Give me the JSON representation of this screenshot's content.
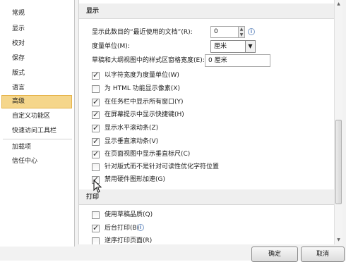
{
  "sidebar": {
    "items": [
      {
        "label": "常规"
      },
      {
        "label": "显示"
      },
      {
        "label": "校对"
      },
      {
        "label": "保存"
      },
      {
        "label": "版式"
      },
      {
        "label": "语言"
      },
      {
        "label": "高级",
        "selected": true
      },
      {
        "label": "自定义功能区"
      },
      {
        "label": "快速访问工具栏"
      },
      {
        "label": "加载项"
      },
      {
        "label": "信任中心"
      }
    ]
  },
  "display_section": {
    "title": "显示",
    "recent_docs_label": "显示此数目的“最近使用的文档”(R):",
    "recent_docs_value": "0",
    "units_label": "度量单位(M):",
    "units_value": "厘米",
    "style_width_label": "草稿和大纲视图中的样式区窗格宽度(E):",
    "style_width_value": "0 厘米",
    "options": [
      {
        "label": "以字符宽度为度量单位(W)",
        "checked": true
      },
      {
        "label": "为 HTML 功能显示像素(X)",
        "checked": false
      },
      {
        "label": "在任务栏中显示所有窗口(Y)",
        "checked": true
      },
      {
        "label": "在屏幕提示中显示快捷键(H)",
        "checked": true
      },
      {
        "label": "显示水平滚动条(Z)",
        "checked": true
      },
      {
        "label": "显示垂直滚动条(V)",
        "checked": true
      },
      {
        "label": "在页面视图中显示垂直标尺(C)",
        "checked": true
      },
      {
        "label": "针对版式而不是针对可读性优化字符位置",
        "checked": false
      },
      {
        "label": "禁用硬件图形加速(G)",
        "checked": true
      }
    ]
  },
  "print_section": {
    "title": "打印",
    "options": [
      {
        "label": "使用草稿品质(Q)",
        "checked": false
      },
      {
        "label": "后台打印(B)",
        "checked": true
      },
      {
        "label": "逆序打印页面(R)",
        "checked": false
      }
    ]
  },
  "footer": {
    "ok_label": "确定",
    "cancel_label": "取消"
  },
  "icons": {
    "info": "info-icon",
    "dropdown": "chevron-down-icon",
    "spin": "spin-arrows-icon"
  },
  "colors": {
    "selected_bg": "#f5d68b",
    "selected_border": "#e5b349"
  }
}
